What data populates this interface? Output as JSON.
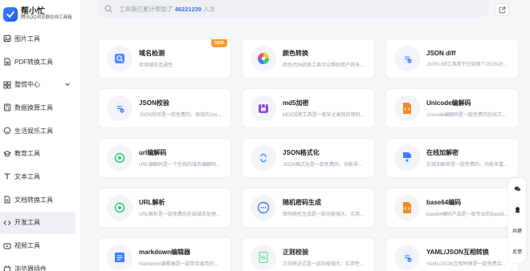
{
  "brand": {
    "name": "帮小忙",
    "subtitle": "腾讯QQ浏览器在线工具箱"
  },
  "sidebar": {
    "items": [
      {
        "label": "图片工具",
        "icon": "image-icon"
      },
      {
        "label": "PDF转换工具",
        "icon": "pdf-icon"
      },
      {
        "label": "整慌中心",
        "icon": "grid-icon",
        "expandable": true
      },
      {
        "label": "数据换算工具",
        "icon": "calculator-icon"
      },
      {
        "label": "生活娱乐工具",
        "icon": "leisure-icon"
      },
      {
        "label": "教育工具",
        "icon": "education-icon"
      },
      {
        "label": "文本工具",
        "icon": "text-icon"
      },
      {
        "label": "文档转换工具",
        "icon": "document-icon"
      },
      {
        "label": "开发工具",
        "icon": "code-icon",
        "active": true
      },
      {
        "label": "视频工具",
        "icon": "video-icon"
      },
      {
        "label": "浏览器插件",
        "icon": "plugin-icon"
      }
    ]
  },
  "search": {
    "prefix": "工具箱已累计帮助了",
    "count": "46221239",
    "suffix": "人次"
  },
  "tools": [
    {
      "title": "域名检测",
      "desc": "检测域名连通性",
      "icon": "domain-check-icon",
      "badge": "NEW",
      "color": "#3d7cff"
    },
    {
      "title": "颜色转换",
      "desc": "颜色代码转换工具可以帮助用户将多...",
      "icon": "color-wheel-icon",
      "color": "#e94f6f"
    },
    {
      "title": "JSON diff",
      "desc": "JSON diff工具用于比较两个JSON对...",
      "icon": "json-diff-icon",
      "color": "#3d7cff"
    },
    {
      "title": "JSON校验",
      "desc": "JSON校验是一款免费的、高效的Jso...",
      "icon": "json-check-icon",
      "color": "#3d7cff"
    },
    {
      "title": "md5加密",
      "desc": "MD5加密工具是一款安全高效的密码...",
      "icon": "lock-icon",
      "color": "#8e44e8"
    },
    {
      "title": "Unicode编解码",
      "desc": "Unicode编解码是一款免费的在线工...",
      "icon": "code-brackets-icon",
      "color": "#f08a24"
    },
    {
      "title": "url编解码",
      "desc": "URL编解码是一个在线的域名编解码...",
      "icon": "url-icon",
      "color": "#2ecc71"
    },
    {
      "title": "JSON格式化",
      "desc": "JSON格式化是一款免费的、功能丰...",
      "icon": "json-format-icon",
      "color": "#3d7cff"
    },
    {
      "title": "在线加解密",
      "desc": "在线加解密是一款免费的、功能丰富...",
      "icon": "encrypt-icon",
      "color": "#3d7cff"
    },
    {
      "title": "URL解析",
      "desc": "URL解析是一款免费的在线域名处理...",
      "icon": "url-parse-icon",
      "color": "#2ecc71"
    },
    {
      "title": "随机密码生成",
      "desc": "密码随机生成是一款功能强大、实用...",
      "icon": "password-gen-icon",
      "color": "#3d7cff"
    },
    {
      "title": "base64编码",
      "desc": "base64编码产品是一款专业的Base6...",
      "icon": "base64-icon",
      "color": "#f08a24"
    },
    {
      "title": "markdown编辑器",
      "desc": "Markdown编辑器是一款简单易用的...",
      "icon": "markdown-icon",
      "color": "#3d7cff"
    },
    {
      "title": "正则校验",
      "desc": "正则表达式是一款功能强大、实用性...",
      "icon": "regex-icon",
      "color": "#2ecc71"
    },
    {
      "title": "YAML/JSON互相转换",
      "desc": "YAML/JSON互相转换是一款免费且...",
      "icon": "yaml-json-icon",
      "color": "#3d7cff"
    }
  ],
  "float_toolbar": {
    "share": "共建",
    "feedback": "反馈"
  },
  "colors": {
    "accent": "#3d6ee8",
    "badge": "#ff9a2e"
  }
}
